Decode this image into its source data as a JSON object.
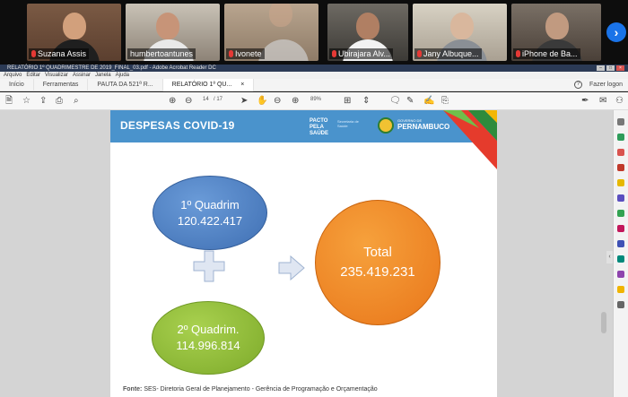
{
  "video_strip": {
    "participants": [
      {
        "name": "Suzana Assis",
        "muted": true
      },
      {
        "name": "humbertoantunes",
        "muted": false
      },
      {
        "name": "Ivonete",
        "muted": true
      },
      {
        "name": "Ubirajara Alv...",
        "muted": true
      },
      {
        "name": "Jany Albuque...",
        "muted": true
      },
      {
        "name": "iPhone de Ba...",
        "muted": true
      }
    ],
    "next_icon": "chevron-right-icon"
  },
  "window": {
    "title": "RELATÓRIO 1º QUADRIMESTRE DE 2019_FINAL_03.pdf - Adobe Acrobat Reader DC",
    "menu": [
      "Arquivo",
      "Editar",
      "Visualizar",
      "Assinar",
      "Janela",
      "Ajuda"
    ]
  },
  "tabs": {
    "home": "Início",
    "tools": "Ferramentas",
    "doc1": "PAUTA DA 521ª R...",
    "doc2": "RELATÓRIO 1º QU...",
    "doc2_close": "×",
    "help": "?",
    "login": "Fazer logon"
  },
  "toolbar": {
    "page_current": "14",
    "page_total": "/ 17",
    "zoom": "89%"
  },
  "slide": {
    "title": "DESPESAS COVID-19",
    "logo_pacto": "PACTO PELA SAÚDE",
    "logo_sec": "Secretaria de Saúde",
    "logo_gov_label": "GOVERNO DE",
    "logo_gov": "PERNAMBUCO",
    "q1_label": "1º Quadrim",
    "q1_value": "120.422.417",
    "q2_label": "2º Quadrim.",
    "q2_value": "114.996.814",
    "total_label": "Total",
    "total_value": "235.419.231",
    "source_label": "Fonte:",
    "source_text": "SES- Diretoria Geral de Planejamento - Gerência de Programação e Orçamentação"
  },
  "colors": {
    "header_blue": "#4a93cc",
    "ellipse_blue": "#4f7fc1",
    "ellipse_green": "#8dbb35",
    "ellipse_orange": "#ef8a2a"
  }
}
